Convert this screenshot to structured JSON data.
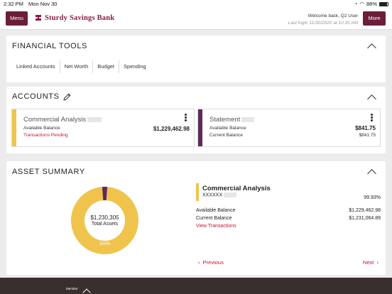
{
  "status": {
    "time": "2:32 PM",
    "date": "Mon Nov 30",
    "battery": "88%",
    "battery_level": 0.88
  },
  "header": {
    "menu_label": "Menu",
    "more_label": "More",
    "bank_name": "Sturdy Savings Bank",
    "welcome": "Welcome back, Q2 User",
    "last_login": "Last login 11/30/2020 at 10:35 AM",
    "brand_color": "#8b1c3b"
  },
  "tools": {
    "title": "FINANCIAL TOOLS",
    "links": [
      "Linked Accounts",
      "Net Worth",
      "Budget",
      "Spending"
    ]
  },
  "accounts": {
    "title": "ACCOUNTS",
    "items": [
      {
        "name": "Commercial Analysis",
        "available_label": "Available Balance",
        "available": "$1,229,462.98",
        "status": "Transactions Pending",
        "color": "#f0c44c"
      },
      {
        "name": "Statement",
        "available_label": "Available Balance",
        "available": "$841.75",
        "current_label": "Current Balance",
        "current": "$841.75",
        "color": "#5e2a5a"
      }
    ]
  },
  "asset_summary": {
    "title": "ASSET SUMMARY",
    "total": "$1,230,305",
    "total_label": "Total Assets",
    "donut_pct": "100%",
    "detail": {
      "name": "Commercial Analysis",
      "number": "XXXXXX",
      "pct": "99.93%",
      "available_label": "Available Balance",
      "available": "$1,229,462.98",
      "current_label": "Current Balance",
      "current": "$1,231,064.89",
      "link": "View Transactions"
    },
    "prev": "Previous",
    "next": "Next",
    "chart_data": {
      "type": "pie",
      "categories": [
        "Commercial Analysis",
        "Statement"
      ],
      "values": [
        99.93,
        0.07
      ],
      "colors": [
        "#f0c44c",
        "#5e2a5a"
      ]
    }
  },
  "bottom": {
    "tab_label": "Member"
  }
}
